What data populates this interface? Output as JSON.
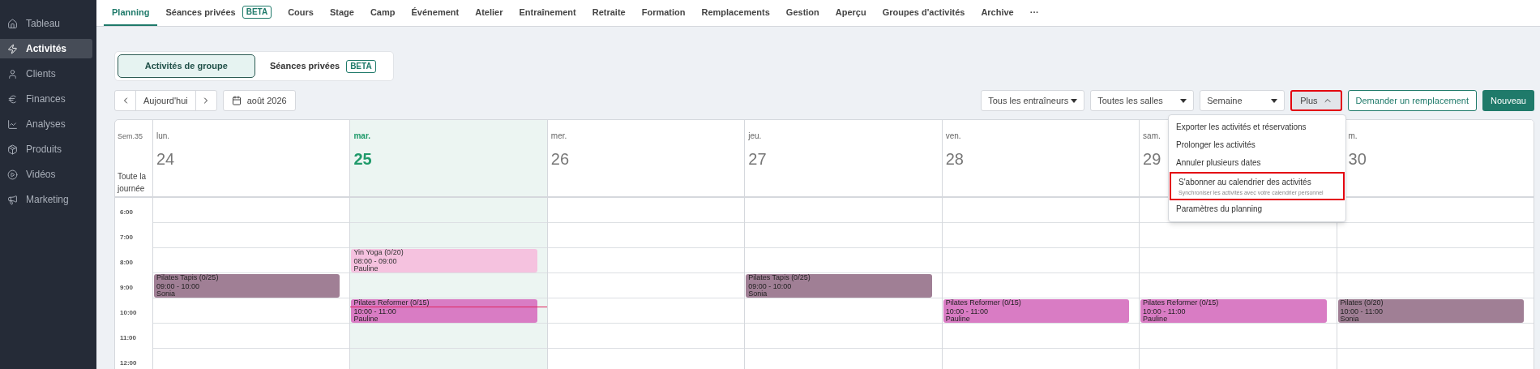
{
  "sidebar": {
    "items": [
      {
        "label": "Tableau",
        "selected": false
      },
      {
        "label": "Activités",
        "selected": true
      },
      {
        "label": "Clients",
        "selected": false
      },
      {
        "label": "Finances",
        "selected": false
      },
      {
        "label": "Analyses",
        "selected": false
      },
      {
        "label": "Produits",
        "selected": false
      },
      {
        "label": "Vidéos",
        "selected": false
      },
      {
        "label": "Marketing",
        "selected": false
      }
    ]
  },
  "tabs": [
    {
      "label": "Planning",
      "selected": true
    },
    {
      "label": "Séances privées",
      "badge": "BETA",
      "selected": false
    },
    {
      "label": "Cours",
      "selected": false
    },
    {
      "label": "Stage",
      "selected": false
    },
    {
      "label": "Camp",
      "selected": false
    },
    {
      "label": "Événement",
      "selected": false
    },
    {
      "label": "Atelier",
      "selected": false
    },
    {
      "label": "Entraînement",
      "selected": false
    },
    {
      "label": "Retraite",
      "selected": false
    },
    {
      "label": "Formation",
      "selected": false
    },
    {
      "label": "Remplacements",
      "selected": false
    },
    {
      "label": "Gestion",
      "selected": false
    },
    {
      "label": "Aperçu",
      "selected": false
    },
    {
      "label": "Groupes d'activités",
      "selected": false
    },
    {
      "label": "Archive",
      "selected": false
    },
    {
      "label": "···",
      "selected": false
    }
  ],
  "segments": [
    {
      "label": "Activités de groupe",
      "selected": true
    },
    {
      "label": "Séances privées",
      "badge": "BETA",
      "selected": false
    }
  ],
  "toolbar": {
    "today": "Aujourd'hui",
    "month": "août 2026",
    "filters": [
      "Tous les entraîneurs",
      "Toutes les salles",
      "Semaine"
    ],
    "more": {
      "label": "Plus",
      "expanded": true,
      "highlighted": true
    },
    "replace": "Demander un remplacement",
    "new": "Nouveau"
  },
  "menu": {
    "items": [
      {
        "label": "Exporter les activités et réservations",
        "highlighted": false
      },
      {
        "label": "Prolonger les activités",
        "highlighted": false
      },
      {
        "label": "Annuler plusieurs dates",
        "highlighted": false
      },
      {
        "label": "S'abonner au calendrier des activités",
        "hint": "Synchroniser les activités avec votre calendrier personnel",
        "highlighted": true
      },
      {
        "label": "Paramètres du planning",
        "highlighted": false
      }
    ]
  },
  "calendar": {
    "week": "Sem.35",
    "all_day": "Toute la journée",
    "hours": [
      "6:00",
      "7:00",
      "8:00",
      "9:00",
      "10:00",
      "11:00",
      "12:00"
    ],
    "days": [
      {
        "name": "lun.",
        "date": "24",
        "today": false,
        "events": [
          {
            "title": "Pilates Tapis (0/25)",
            "time": "09:00 - 10:00",
            "trainer": "Sonia",
            "color": "#a07f95"
          }
        ]
      },
      {
        "name": "mar.",
        "date": "25",
        "today": true,
        "events": [
          {
            "title": "Yin Yoga (0/20)",
            "time": "08:00 - 09:00",
            "trainer": "Pauline",
            "color": "#f5c2df"
          },
          {
            "title": "Pilates Reformer (0/15)",
            "time": "10:00 - 11:00",
            "trainer": "Pauline",
            "color": "#d97cc4"
          }
        ]
      },
      {
        "name": "mer.",
        "date": "26",
        "today": false
      },
      {
        "name": "jeu.",
        "date": "27",
        "today": false,
        "events": [
          {
            "title": "Pilates Tapis (0/25)",
            "time": "09:00 - 10:00",
            "trainer": "Sonia",
            "color": "#a07f95"
          }
        ]
      },
      {
        "name": "ven.",
        "date": "28",
        "today": false,
        "events": [
          {
            "title": "Pilates Reformer (0/15)",
            "time": "10:00 - 11:00",
            "trainer": "Pauline",
            "color": "#d97cc4"
          }
        ]
      },
      {
        "name": "sam.",
        "date": "29",
        "today": false,
        "events": [
          {
            "title": "Pilates Reformer (0/15)",
            "time": "10:00 - 11:00",
            "trainer": "Pauline",
            "color": "#d97cc4"
          }
        ]
      },
      {
        "name": "m.",
        "date": "30",
        "today": false,
        "events": [
          {
            "title": "Pilates (0/20)",
            "time": "10:00 - 11:00",
            "trainer": "Sonia",
            "color": "#a07f95"
          }
        ]
      }
    ]
  }
}
